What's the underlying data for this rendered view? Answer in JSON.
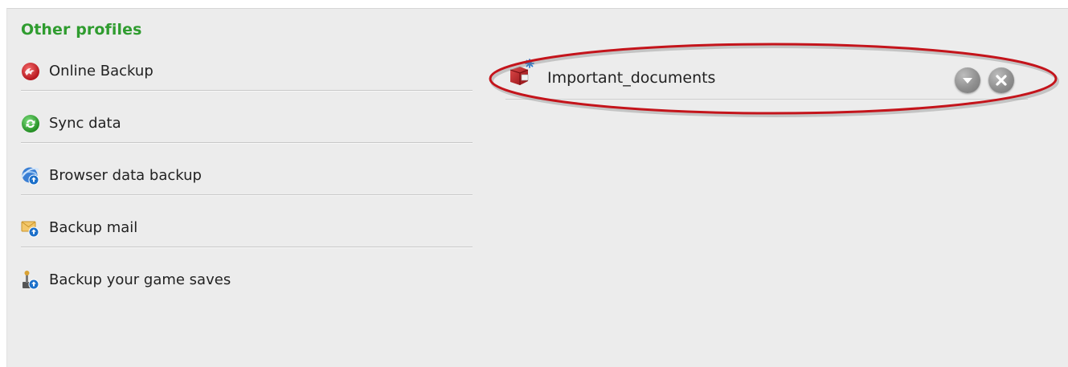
{
  "section": {
    "title": "Other profiles"
  },
  "profiles": [
    {
      "label": "Online Backup",
      "icon": "online-backup-icon"
    },
    {
      "label": "Sync data",
      "icon": "sync-icon"
    },
    {
      "label": "Browser data backup",
      "icon": "browser-backup-icon"
    },
    {
      "label": "Backup mail",
      "icon": "mail-backup-icon"
    },
    {
      "label": "Backup your game saves",
      "icon": "game-saves-backup-icon"
    }
  ],
  "selected_profile": {
    "label": "Important_documents",
    "icon": "new-profile-icon",
    "actions": [
      "expand-icon",
      "remove-icon"
    ]
  },
  "colors": {
    "title_green": "#2f9c2f",
    "panel_bg": "#ececec",
    "highlight_red": "#c4141b"
  }
}
